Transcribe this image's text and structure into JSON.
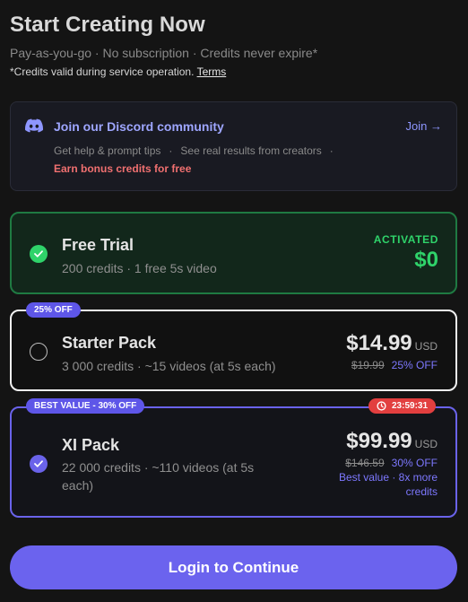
{
  "header": {
    "title": "Start Creating Now",
    "subtitle": "Pay-as-you-go · No subscription · Credits never expire*",
    "note": "*Credits valid during service operation. ",
    "terms_link": "Terms"
  },
  "discord": {
    "icon": "discord-icon",
    "title": "Join our Discord community",
    "join_label": "Join →",
    "tips": [
      "Get help & prompt tips",
      "See real results from creators"
    ],
    "separator": "·",
    "bonus": "Earn bonus credits for free"
  },
  "plans": [
    {
      "name": "Free Trial",
      "description": "200 credits · 1 free 5s video",
      "status": "ACTIVATED",
      "price": "$0",
      "selected": true
    },
    {
      "name": "Starter Pack",
      "description": "3 000 credits · ~15 videos (at 5s each)",
      "badge": "25% OFF",
      "price": "$14.99",
      "currency": "USD",
      "old_price": "$19.99",
      "discount": "25% OFF",
      "selected": false
    },
    {
      "name": "XI Pack",
      "description": "22 000 credits · ~110 videos (at 5s each)",
      "badge": "BEST VALUE - 30% OFF",
      "timer": "23:59:31",
      "price": "$99.99",
      "currency": "USD",
      "old_price": "$146.59",
      "discount": "30% OFF",
      "value_note": "Best value · 8x more credits",
      "selected": true
    }
  ],
  "cta": {
    "label": "Login to Continue"
  },
  "colors": {
    "accent": "#6b63ee",
    "success": "#2fd36a",
    "danger": "#e23f3f",
    "background": "#141414"
  }
}
